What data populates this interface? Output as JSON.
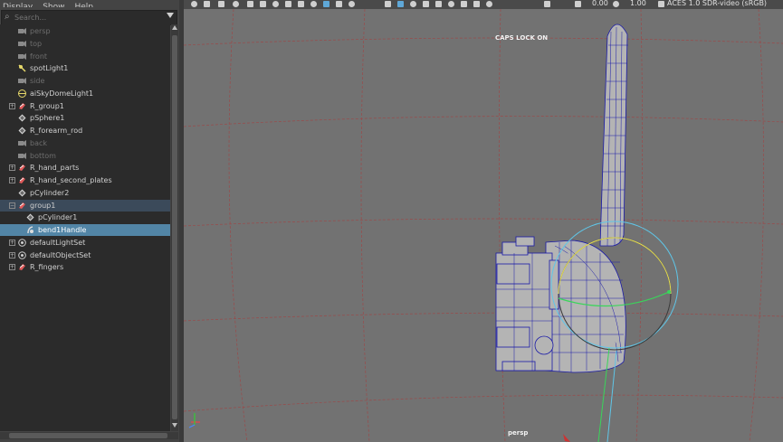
{
  "outliner": {
    "menu": [
      "Display",
      "Show",
      "Help"
    ],
    "search_placeholder": "Search...",
    "items": [
      {
        "label": "persp",
        "icon": "camera-icon",
        "dim": true,
        "expander": ""
      },
      {
        "label": "top",
        "icon": "camera-icon",
        "dim": true,
        "expander": ""
      },
      {
        "label": "front",
        "icon": "camera-icon",
        "dim": true,
        "expander": ""
      },
      {
        "label": "spotLight1",
        "icon": "spotlight-icon",
        "dim": false,
        "expander": ""
      },
      {
        "label": "side",
        "icon": "camera-icon",
        "dim": true,
        "expander": ""
      },
      {
        "label": "aiSkyDomeLight1",
        "icon": "skydome-icon",
        "dim": false,
        "expander": ""
      },
      {
        "label": "R_group1",
        "icon": "group-icon",
        "dim": false,
        "expander": "+"
      },
      {
        "label": "pSphere1",
        "icon": "mesh-icon",
        "dim": false,
        "expander": ""
      },
      {
        "label": "R_forearm_rod",
        "icon": "mesh-icon",
        "dim": false,
        "expander": ""
      },
      {
        "label": "back",
        "icon": "camera-icon",
        "dim": true,
        "expander": ""
      },
      {
        "label": "bottom",
        "icon": "camera-icon",
        "dim": true,
        "expander": ""
      },
      {
        "label": "R_hand_parts",
        "icon": "group-icon",
        "dim": false,
        "expander": "+"
      },
      {
        "label": "R_hand_second_plates",
        "icon": "group-icon",
        "dim": false,
        "expander": "+"
      },
      {
        "label": "pCylinder2",
        "icon": "mesh-icon",
        "dim": false,
        "expander": ""
      },
      {
        "label": "group1",
        "icon": "group-icon",
        "dim": false,
        "expander": "−",
        "state": "parent-sel"
      },
      {
        "label": "pCylinder1",
        "icon": "mesh-icon",
        "dim": false,
        "expander": "",
        "indent": 1
      },
      {
        "label": "bend1Handle",
        "icon": "deformer-icon",
        "dim": false,
        "expander": "",
        "indent": 1,
        "state": "sel"
      },
      {
        "label": "defaultLightSet",
        "icon": "set-icon",
        "dim": false,
        "expander": "+"
      },
      {
        "label": "defaultObjectSet",
        "icon": "set-icon",
        "dim": false,
        "expander": "+"
      },
      {
        "label": "R_fingers",
        "icon": "group-icon",
        "dim": false,
        "expander": "+"
      }
    ]
  },
  "viewport": {
    "toolbar": {
      "value_a": "0.00",
      "value_b": "1.00",
      "color_space": "ACES 1.0 SDR-video (sRGB)"
    },
    "hud_caps": "CAPS LOCK ON",
    "camera_name": "persp"
  },
  "colors": {
    "selected_row": "#5285a6",
    "parent_row": "#3b4a5a",
    "wire": "#1a1aa8",
    "grid": "#9a4a4a",
    "handle_cyan": "#5fc6e8",
    "handle_yellow": "#e8e050",
    "handle_green": "#39d65a"
  }
}
